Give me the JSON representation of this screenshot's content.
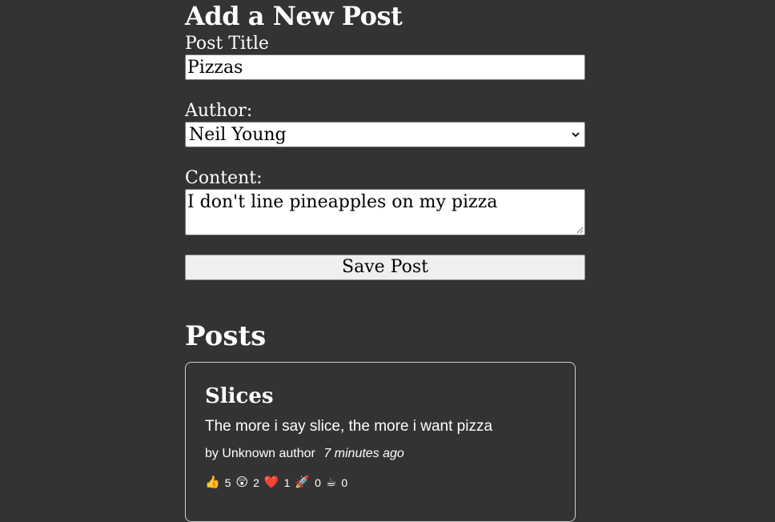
{
  "form": {
    "heading": "Add a New Post",
    "title_label": "Post Title",
    "title_value": "Pizzas",
    "author_label": "Author:",
    "author_selected": "Neil Young",
    "content_label": "Content:",
    "content_value": "I don't line pineapples on my pizza",
    "save_label": "Save Post"
  },
  "posts_section": {
    "heading": "Posts",
    "posts": [
      {
        "title": "Slices",
        "content": "The more i say slice, the more i want pizza",
        "author_text": "by Unknown author",
        "time_text": "7 minutes ago",
        "reactions": [
          {
            "icon": "thumbs-up-icon",
            "glyph": "👍",
            "count": "5"
          },
          {
            "icon": "amazed-face-icon",
            "glyph": "😲",
            "count": "2"
          },
          {
            "icon": "heart-icon",
            "glyph": "❤️",
            "count": "1"
          },
          {
            "icon": "rocket-icon",
            "glyph": "🚀",
            "count": "0"
          },
          {
            "icon": "coffee-icon",
            "glyph": "☕",
            "count": "0"
          }
        ]
      }
    ]
  },
  "colors": {
    "background": "#333333",
    "text": "#ffffff",
    "input_bg": "#ffffff",
    "button_bg": "#efefef"
  }
}
